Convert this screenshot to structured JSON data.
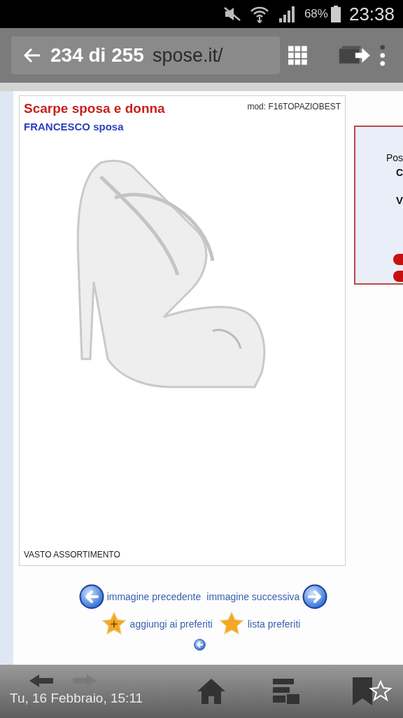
{
  "status_bar": {
    "battery": "68%",
    "time": "23:38"
  },
  "toolbar": {
    "url": "spose.it/",
    "counter": "234 di 255"
  },
  "product": {
    "title": "Scarpe sposa e donna",
    "brand": "FRANCESCO",
    "brand_suffix": "sposa",
    "model": "mod: F16TOPAZIOBEST",
    "caption": "VASTO ASSORTIMENTO"
  },
  "side_panel": {
    "lines": [
      "Pos",
      "C",
      "V"
    ]
  },
  "nav": {
    "previous": "immagine precedente",
    "next": "immagine successiva",
    "add_favorite": "aggiungi ai preferiti",
    "favorites": "lista preferiti"
  },
  "bottom_bar": {
    "date": "Tu, 16 Febbraio, 15:11"
  }
}
